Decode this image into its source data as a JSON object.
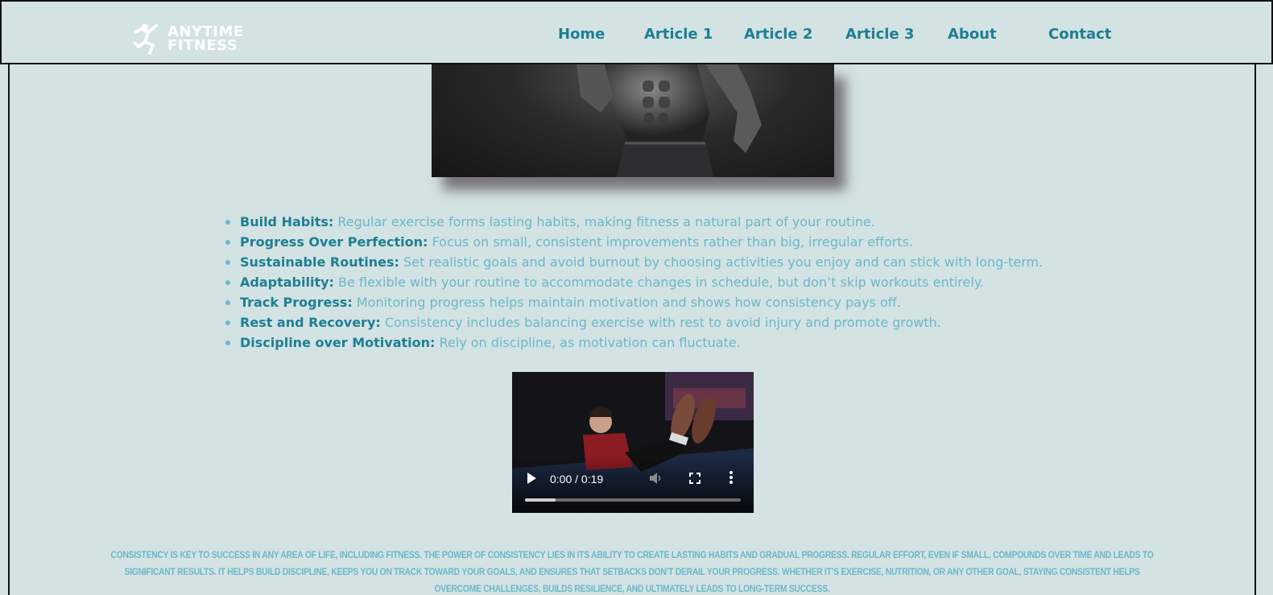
{
  "brand": {
    "line1": "ANYTIME",
    "line2": "FITNESS",
    "icon": "running-figure-logo-icon"
  },
  "nav": {
    "items": [
      {
        "label": "Home"
      },
      {
        "label": "Article 1"
      },
      {
        "label": "Article 2"
      },
      {
        "label": "Article 3"
      },
      {
        "label": "About"
      },
      {
        "label": "Contact"
      }
    ]
  },
  "hero": {
    "alt": "muscular man in dark studio"
  },
  "bullets": [
    {
      "term": "Build Habits:",
      "text": " Regular exercise forms lasting habits, making fitness a natural part of your routine."
    },
    {
      "term": "Progress Over Perfection:",
      "text": " Focus on small, consistent improvements rather than big, irregular efforts."
    },
    {
      "term": "Sustainable Routines:",
      "text": " Set realistic goals and avoid burnout by choosing activities you enjoy and can stick with long-term."
    },
    {
      "term": "Adaptability:",
      "text": " Be flexible with your routine to accommodate changes in schedule, but don’t skip workouts entirely."
    },
    {
      "term": "Track Progress:",
      "text": " Monitoring progress helps maintain motivation and shows how consistency pays off."
    },
    {
      "term": "Rest and Recovery:",
      "text": " Consistency includes balancing exercise with rest to avoid injury and promote growth."
    },
    {
      "term": "Discipline over Motivation:",
      "text": " Rely on discipline, as motivation can fluctuate."
    }
  ],
  "video": {
    "time": "0:00 / 0:19",
    "progress": 0.14,
    "icons": {
      "play": "play-icon",
      "volume": "volume-icon",
      "fullscreen": "fullscreen-icon",
      "more": "more-vertical-icon"
    }
  },
  "footer": {
    "text": "Consistency is key to success in any area of life, including fitness. The power of consistency lies in its ability to create lasting habits and gradual progress. Regular effort, even if small, compounds over time and leads to significant results. It helps build discipline, keeps you on track toward your goals, and ensures that setbacks don’t derail your progress. Whether it’s exercise, nutrition, or any other goal, staying consistent helps overcome challenges, builds resilience, and ultimately leads to long-term success."
  },
  "colors": {
    "background": "#d3e2e3",
    "nav_text": "#1d7f93",
    "body_text": "#6cb8c9",
    "term_text": "#1d7f93"
  }
}
